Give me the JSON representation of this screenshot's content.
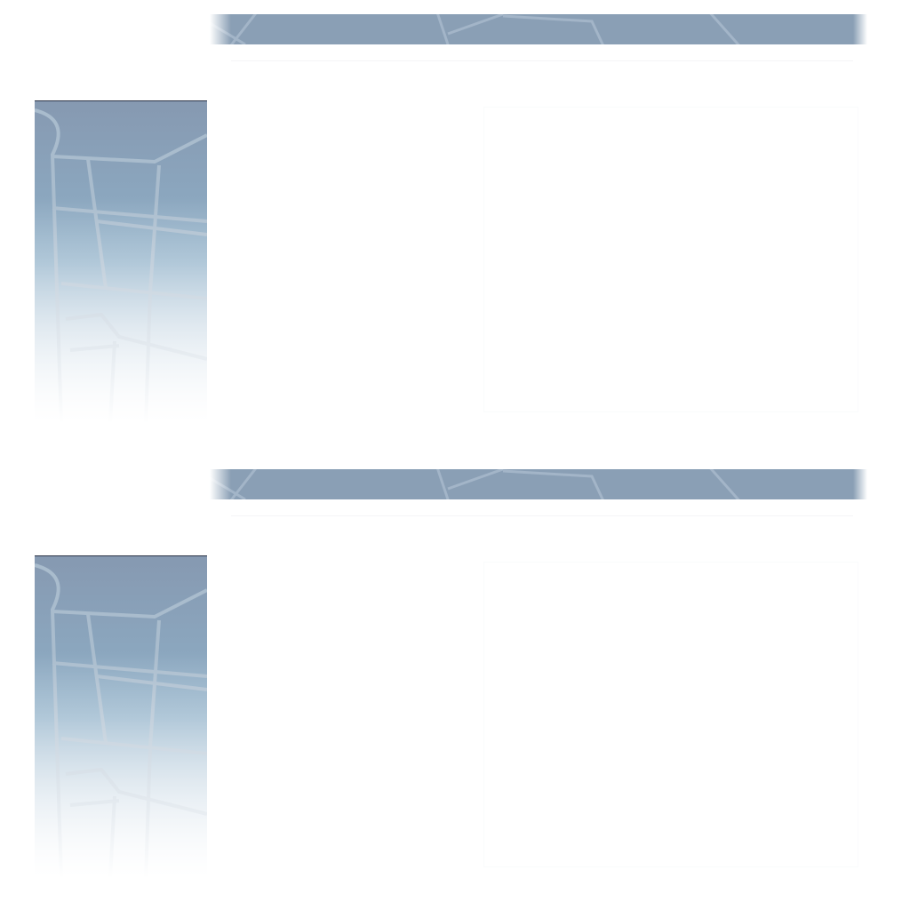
{
  "theme": {
    "banner_color": "#8a9fb5",
    "map_top_color": "#8699b1",
    "map_road_color": "#a9bccd",
    "background": "#ffffff"
  },
  "sections": [
    {
      "banner_icon": "map-pattern",
      "sidebar_icon": "map-pattern"
    },
    {
      "banner_icon": "map-pattern",
      "sidebar_icon": "map-pattern"
    }
  ]
}
